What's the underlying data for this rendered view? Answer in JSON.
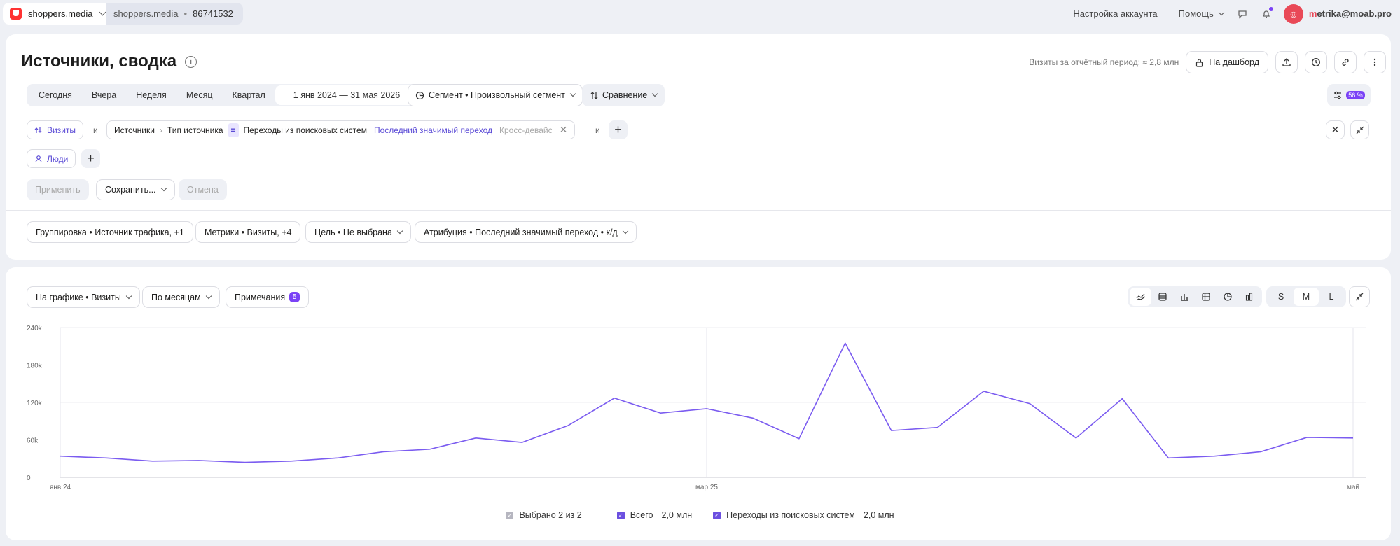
{
  "topbar": {
    "account": "shoppers.media",
    "counter_name": "shoppers.media",
    "counter_id": "86741532",
    "settings": "Настройка аккаунта",
    "help": "Помощь",
    "user_prefix": "m",
    "user_rest": "etrika@moab.pro"
  },
  "header": {
    "title": "Источники, сводка",
    "visits_info": "Визиты за отчётный период: ≈ 2,8 млн",
    "dashboard_btn": "На дашборд"
  },
  "period": {
    "options": [
      "Сегодня",
      "Вчера",
      "Неделя",
      "Месяц",
      "Квартал"
    ],
    "range": "1 янв 2024 — 31 мая 2026",
    "segment": "Сегмент • Произвольный сегмент",
    "compare": "Сравнение",
    "sampling": "56 %"
  },
  "filters": {
    "visits": "Визиты",
    "and1": "и",
    "path_1": "Источники",
    "path_2": "Тип источника",
    "eq": "=",
    "value": "Переходы из поисковых систем",
    "attribution": "Последний значимый переход",
    "cross_device": "Кросс-девайс",
    "and2": "и",
    "people": "Люди"
  },
  "actions": {
    "apply": "Применить",
    "save": "Сохранить...",
    "cancel": "Отмена"
  },
  "report_settings": {
    "grouping": "Группировка • Источник трафика, +1",
    "metrics": "Метрики • Визиты, +4",
    "goal": "Цель • Не выбрана",
    "attribution": "Атрибуция • Последний значимый переход • к/д"
  },
  "chart_controls": {
    "on_chart": "На графике • Визиты",
    "by_months": "По месяцам",
    "notes": "Примечания",
    "notes_count": "5",
    "sizes": [
      "S",
      "M",
      "L"
    ],
    "active_size": "M"
  },
  "legend": {
    "selected": "Выбрано 2 из 2",
    "total_label": "Всего",
    "total_value": "2,0 млн",
    "search_label": "Переходы из поисковых систем",
    "search_value": "2,0 млн"
  },
  "chart_data": {
    "type": "line",
    "y_ticks": [
      "0",
      "60k",
      "120k",
      "180k",
      "240k"
    ],
    "ylim": [
      0,
      240000
    ],
    "x_tick_labels": [
      "янв 24",
      "мар 25",
      "май"
    ],
    "x_tick_index": [
      0,
      14,
      28
    ],
    "series": [
      {
        "name": "Переходы из поисковых систем",
        "color": "#7b5cf0",
        "values": [
          34000,
          31000,
          26000,
          27000,
          24000,
          26000,
          31000,
          41000,
          45000,
          63000,
          56000,
          83000,
          127000,
          103000,
          110000,
          95000,
          62000,
          215000,
          75000,
          80000,
          138000,
          118000,
          63000,
          126000,
          31000,
          34000,
          41000,
          64000,
          63000
        ]
      }
    ],
    "grid": true
  }
}
